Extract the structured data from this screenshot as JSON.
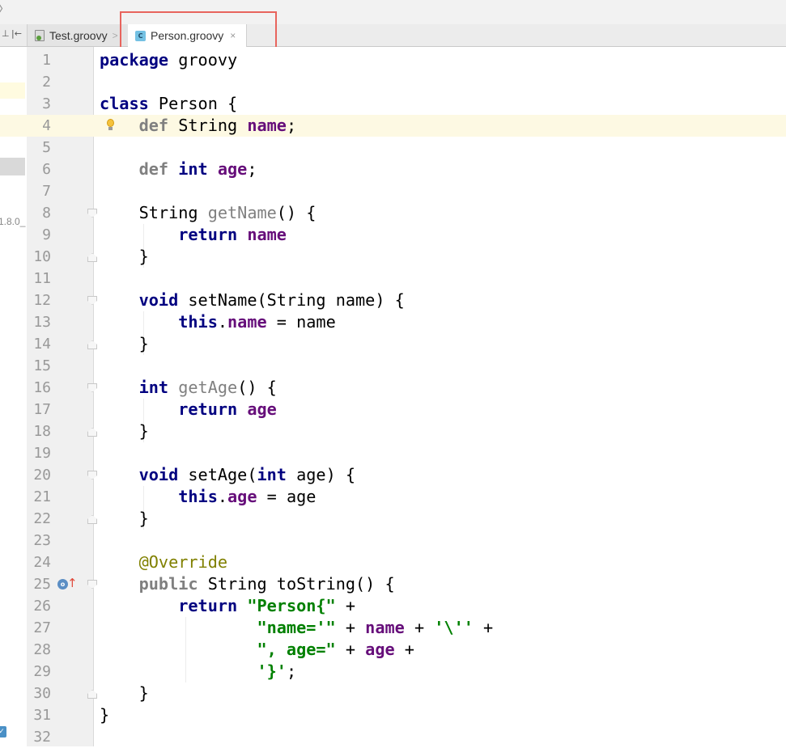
{
  "top_strip": {
    "chevron": "〉"
  },
  "tab_bar": {
    "tools": [
      "⊥",
      "|←"
    ],
    "tabs": [
      {
        "label": "Test.groovy",
        "arrow": ">",
        "active": false
      },
      {
        "label": "Person.groovy",
        "close": "×",
        "active": true
      }
    ]
  },
  "left_pane": {
    "sdk_label": "1.8.0_"
  },
  "editor": {
    "current_line": 4,
    "lines": [
      {
        "n": "1",
        "tokens": [
          [
            "kw",
            "package"
          ],
          [
            "plain",
            " groovy"
          ]
        ]
      },
      {
        "n": "2",
        "tokens": []
      },
      {
        "n": "3",
        "tokens": [
          [
            "kw",
            "class"
          ],
          [
            "plain",
            " Person {"
          ]
        ]
      },
      {
        "n": "4",
        "tokens": [
          [
            "plain",
            "    "
          ],
          [
            "kw-def",
            "def"
          ],
          [
            "plain",
            " String "
          ],
          [
            "field",
            "name"
          ],
          [
            "plain",
            ";"
          ]
        ]
      },
      {
        "n": "5",
        "tokens": []
      },
      {
        "n": "6",
        "tokens": [
          [
            "plain",
            "    "
          ],
          [
            "kw-def",
            "def"
          ],
          [
            "plain",
            " "
          ],
          [
            "kw",
            "int"
          ],
          [
            "plain",
            " "
          ],
          [
            "field",
            "age"
          ],
          [
            "plain",
            ";"
          ]
        ]
      },
      {
        "n": "7",
        "tokens": []
      },
      {
        "n": "8",
        "tokens": [
          [
            "plain",
            "    String "
          ],
          [
            "meth",
            "getName"
          ],
          [
            "plain",
            "() {"
          ]
        ]
      },
      {
        "n": "9",
        "tokens": [
          [
            "plain",
            "        "
          ],
          [
            "kw",
            "return"
          ],
          [
            "plain",
            " "
          ],
          [
            "field",
            "name"
          ]
        ]
      },
      {
        "n": "10",
        "tokens": [
          [
            "plain",
            "    }"
          ]
        ]
      },
      {
        "n": "11",
        "tokens": []
      },
      {
        "n": "12",
        "tokens": [
          [
            "plain",
            "    "
          ],
          [
            "kw",
            "void"
          ],
          [
            "plain",
            " setName(String name) {"
          ]
        ]
      },
      {
        "n": "13",
        "tokens": [
          [
            "plain",
            "        "
          ],
          [
            "kw",
            "this"
          ],
          [
            "plain",
            "."
          ],
          [
            "field",
            "name"
          ],
          [
            "plain",
            " = name"
          ]
        ]
      },
      {
        "n": "14",
        "tokens": [
          [
            "plain",
            "    }"
          ]
        ]
      },
      {
        "n": "15",
        "tokens": []
      },
      {
        "n": "16",
        "tokens": [
          [
            "plain",
            "    "
          ],
          [
            "kw",
            "int"
          ],
          [
            "plain",
            " "
          ],
          [
            "meth",
            "getAge"
          ],
          [
            "plain",
            "() {"
          ]
        ]
      },
      {
        "n": "17",
        "tokens": [
          [
            "plain",
            "        "
          ],
          [
            "kw",
            "return"
          ],
          [
            "plain",
            " "
          ],
          [
            "field",
            "age"
          ]
        ]
      },
      {
        "n": "18",
        "tokens": [
          [
            "plain",
            "    }"
          ]
        ]
      },
      {
        "n": "19",
        "tokens": []
      },
      {
        "n": "20",
        "tokens": [
          [
            "plain",
            "    "
          ],
          [
            "kw",
            "void"
          ],
          [
            "plain",
            " setAge("
          ],
          [
            "kw",
            "int"
          ],
          [
            "plain",
            " age) {"
          ]
        ]
      },
      {
        "n": "21",
        "tokens": [
          [
            "plain",
            "        "
          ],
          [
            "kw",
            "this"
          ],
          [
            "plain",
            "."
          ],
          [
            "field",
            "age"
          ],
          [
            "plain",
            " = age"
          ]
        ]
      },
      {
        "n": "22",
        "tokens": [
          [
            "plain",
            "    }"
          ]
        ]
      },
      {
        "n": "23",
        "tokens": []
      },
      {
        "n": "24",
        "tokens": [
          [
            "plain",
            "    "
          ],
          [
            "ann",
            "@Override"
          ]
        ]
      },
      {
        "n": "25",
        "tokens": [
          [
            "plain",
            "    "
          ],
          [
            "kw-def",
            "public"
          ],
          [
            "plain",
            " String toString() {"
          ]
        ]
      },
      {
        "n": "26",
        "tokens": [
          [
            "plain",
            "        "
          ],
          [
            "kw",
            "return"
          ],
          [
            "plain",
            " "
          ],
          [
            "str",
            "\"Person{\""
          ],
          [
            "plain",
            " +"
          ]
        ]
      },
      {
        "n": "27",
        "tokens": [
          [
            "plain",
            "                "
          ],
          [
            "str",
            "\"name='\""
          ],
          [
            "plain",
            " + "
          ],
          [
            "field",
            "name"
          ],
          [
            "plain",
            " + "
          ],
          [
            "str",
            "'\\''"
          ],
          [
            "plain",
            " +"
          ]
        ]
      },
      {
        "n": "28",
        "tokens": [
          [
            "plain",
            "                "
          ],
          [
            "str",
            "\", age=\""
          ],
          [
            "plain",
            " + "
          ],
          [
            "field",
            "age"
          ],
          [
            "plain",
            " +"
          ]
        ]
      },
      {
        "n": "29",
        "tokens": [
          [
            "plain",
            "                "
          ],
          [
            "str",
            "'}'"
          ],
          [
            "plain",
            ";"
          ]
        ]
      },
      {
        "n": "30",
        "tokens": [
          [
            "plain",
            "    }"
          ]
        ]
      },
      {
        "n": "31",
        "tokens": [
          [
            "plain",
            "}"
          ]
        ]
      },
      {
        "n": "32",
        "tokens": []
      }
    ],
    "fold_start_lines": [
      8,
      12,
      16,
      20,
      25
    ],
    "fold_end_lines": [
      10,
      14,
      18,
      22,
      30
    ],
    "bulb_line": 4,
    "override_line": 25
  },
  "colors": {
    "keyword": "#000080",
    "field": "#660e7a",
    "string": "#008000",
    "annotation": "#808000",
    "unused": "#808080",
    "current_line_bg": "#fdf9e3",
    "highlight_box": "#e8645d"
  },
  "icons": {
    "bulb": "light-bulb-icon",
    "override": "override-method-icon",
    "groovy_file": "groovy-file-icon",
    "groovy_class": "groovy-class-icon"
  }
}
